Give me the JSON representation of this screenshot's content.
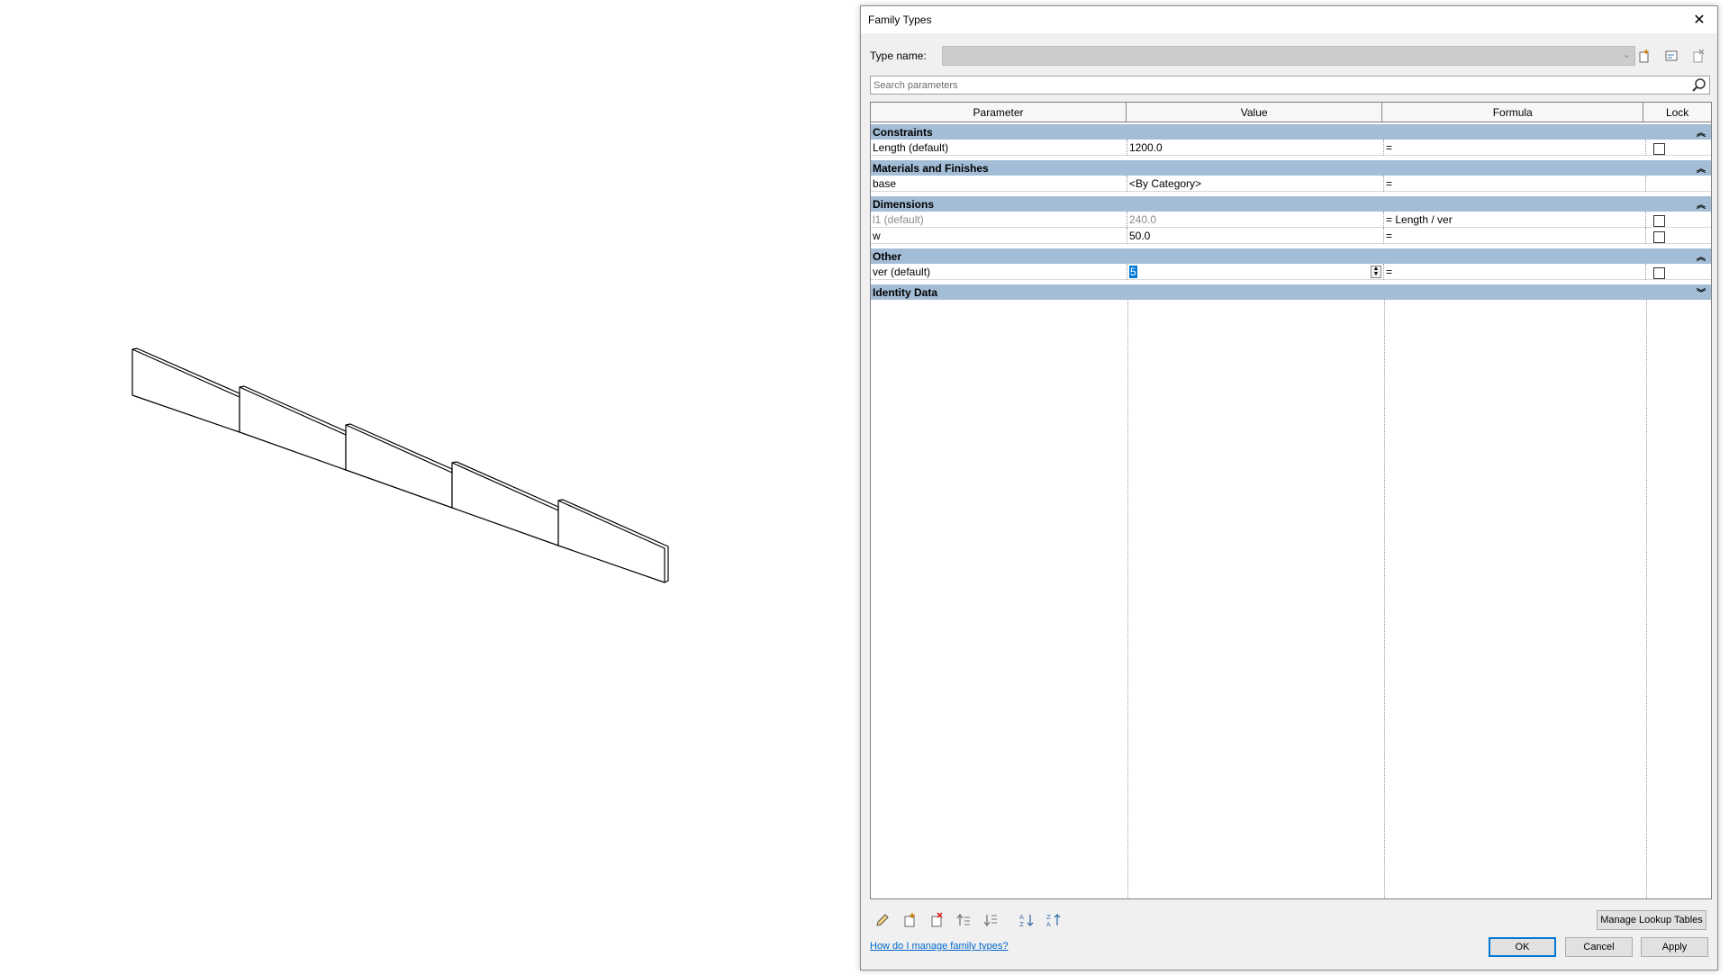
{
  "dialog": {
    "title": "Family Types",
    "type_name_label": "Type name:",
    "type_name_value": "",
    "search_placeholder": "Search parameters",
    "columns": [
      "Parameter",
      "Value",
      "Formula",
      "Lock"
    ],
    "groups": [
      {
        "name": "Constraints",
        "collapsed": false,
        "rows": [
          {
            "parameter": "Length (default)",
            "value": "1200.0",
            "formula": "=",
            "lock": false,
            "lock_visible": true,
            "greyed": false
          }
        ]
      },
      {
        "name": "Materials and Finishes",
        "collapsed": false,
        "rows": [
          {
            "parameter": "base",
            "value": "<By Category>",
            "formula": "=",
            "lock": false,
            "lock_visible": false,
            "greyed": false
          }
        ]
      },
      {
        "name": "Dimensions",
        "collapsed": false,
        "rows": [
          {
            "parameter": "l1 (default)",
            "value": "240.0",
            "formula": "= Length / ver",
            "lock": false,
            "lock_visible": true,
            "greyed": true
          },
          {
            "parameter": "w",
            "value": "50.0",
            "formula": "=",
            "lock": false,
            "lock_visible": true,
            "greyed": false
          }
        ]
      },
      {
        "name": "Other",
        "collapsed": false,
        "rows": [
          {
            "parameter": "ver (default)",
            "value": "5",
            "formula": "=",
            "lock": false,
            "lock_visible": true,
            "greyed": false,
            "editing": true
          }
        ]
      },
      {
        "name": "Identity Data",
        "collapsed": true,
        "rows": []
      }
    ],
    "manage_lookup_label": "Manage Lookup Tables",
    "help_link": "How do I manage family types?",
    "ok_label": "OK",
    "cancel_label": "Cancel",
    "apply_label": "Apply"
  },
  "colors": {
    "group_header": "#a3bdd6",
    "selection": "#0078d7",
    "link": "#0066cc"
  }
}
